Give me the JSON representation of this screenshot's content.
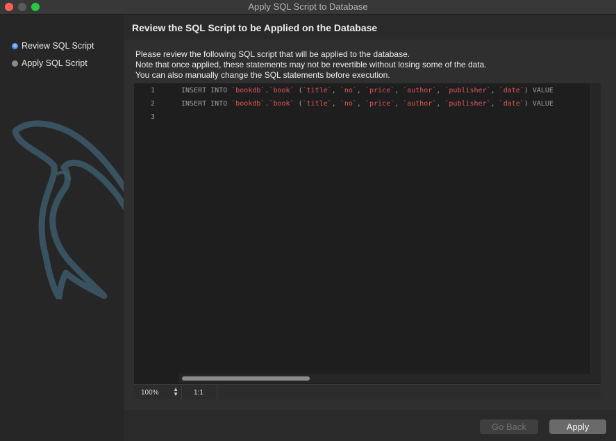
{
  "window": {
    "title": "Apply SQL Script to Database"
  },
  "sidebar": {
    "steps": [
      {
        "label": "Review SQL Script",
        "state": "active"
      },
      {
        "label": "Apply SQL Script",
        "state": "pending"
      }
    ]
  },
  "main": {
    "heading": "Review the SQL Script to be Applied on the Database",
    "description": [
      "Please review the following SQL script that will be applied to the database.",
      "Note that once applied, these statements may not be revertible without losing some of the data.",
      "You can also manually change the SQL statements before execution."
    ]
  },
  "editor": {
    "line_numbers": [
      "1",
      "2",
      "3"
    ],
    "lines": [
      {
        "kw": "INSERT INTO ",
        "schema": "`bookdb`",
        "dot": ".",
        "table": "`book`",
        "open": " (",
        "c1": "`title`",
        "s1": ", ",
        "c2": "`no`",
        "s2": ", ",
        "c3": "`price`",
        "s3": ", ",
        "c4": "`author`",
        "s4": ", ",
        "c5": "`publisher`",
        "s5": ", ",
        "c6": "`date`",
        "close": ") VALUE"
      },
      {
        "kw": "INSERT INTO ",
        "schema": "`bookdb`",
        "dot": ".",
        "table": "`book`",
        "open": " (",
        "c1": "`title`",
        "s1": ", ",
        "c2": "`no`",
        "s2": ", ",
        "c3": "`price`",
        "s3": ", ",
        "c4": "`author`",
        "s4": ", ",
        "c5": "`publisher`",
        "s5": ", ",
        "c6": "`date`",
        "close": ") VALUE"
      }
    ],
    "zoom": "100%",
    "cursor": "1:1"
  },
  "buttons": {
    "back": "Go Back",
    "apply": "Apply"
  },
  "colors": {
    "identifier": "#e0555a",
    "keyword": "#a0a0a0",
    "active_step": "#3a86e8",
    "close": "#ff5f57",
    "zoom": "#28c840"
  },
  "icons": {
    "watermark": "dolphin-logo",
    "zoom_stepper": "up-down-chevron-icon"
  }
}
